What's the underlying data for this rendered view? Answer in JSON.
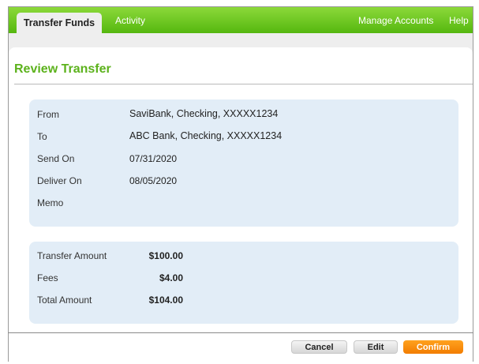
{
  "nav": {
    "tab_transfer_funds": "Transfer Funds",
    "tab_activity": "Activity",
    "manage_accounts": "Manage Accounts",
    "help": "Help"
  },
  "page": {
    "title": "Review Transfer"
  },
  "details": {
    "from_label": "From",
    "from_value": "SaviBank, Checking, XXXXX1234",
    "to_label": "To",
    "to_value": "ABC Bank, Checking, XXXXX1234",
    "send_on_label": "Send On",
    "send_on_value": "07/31/2020",
    "deliver_on_label": "Deliver On",
    "deliver_on_value": "08/05/2020",
    "memo_label": "Memo",
    "memo_value": ""
  },
  "amounts": {
    "transfer_amount_label": "Transfer Amount",
    "transfer_amount_value": "$100.00",
    "fees_label": "Fees",
    "fees_value": "$4.00",
    "total_amount_label": "Total Amount",
    "total_amount_value": "$104.00"
  },
  "actions": {
    "cancel": "Cancel",
    "edit": "Edit",
    "confirm": "Confirm"
  },
  "colors": {
    "nav_green_top": "#8cd93a",
    "nav_green_bottom": "#55b70f",
    "title_green": "#5cb21c",
    "panel_blue": "#e2edf7",
    "confirm_orange": "#f27c00"
  }
}
